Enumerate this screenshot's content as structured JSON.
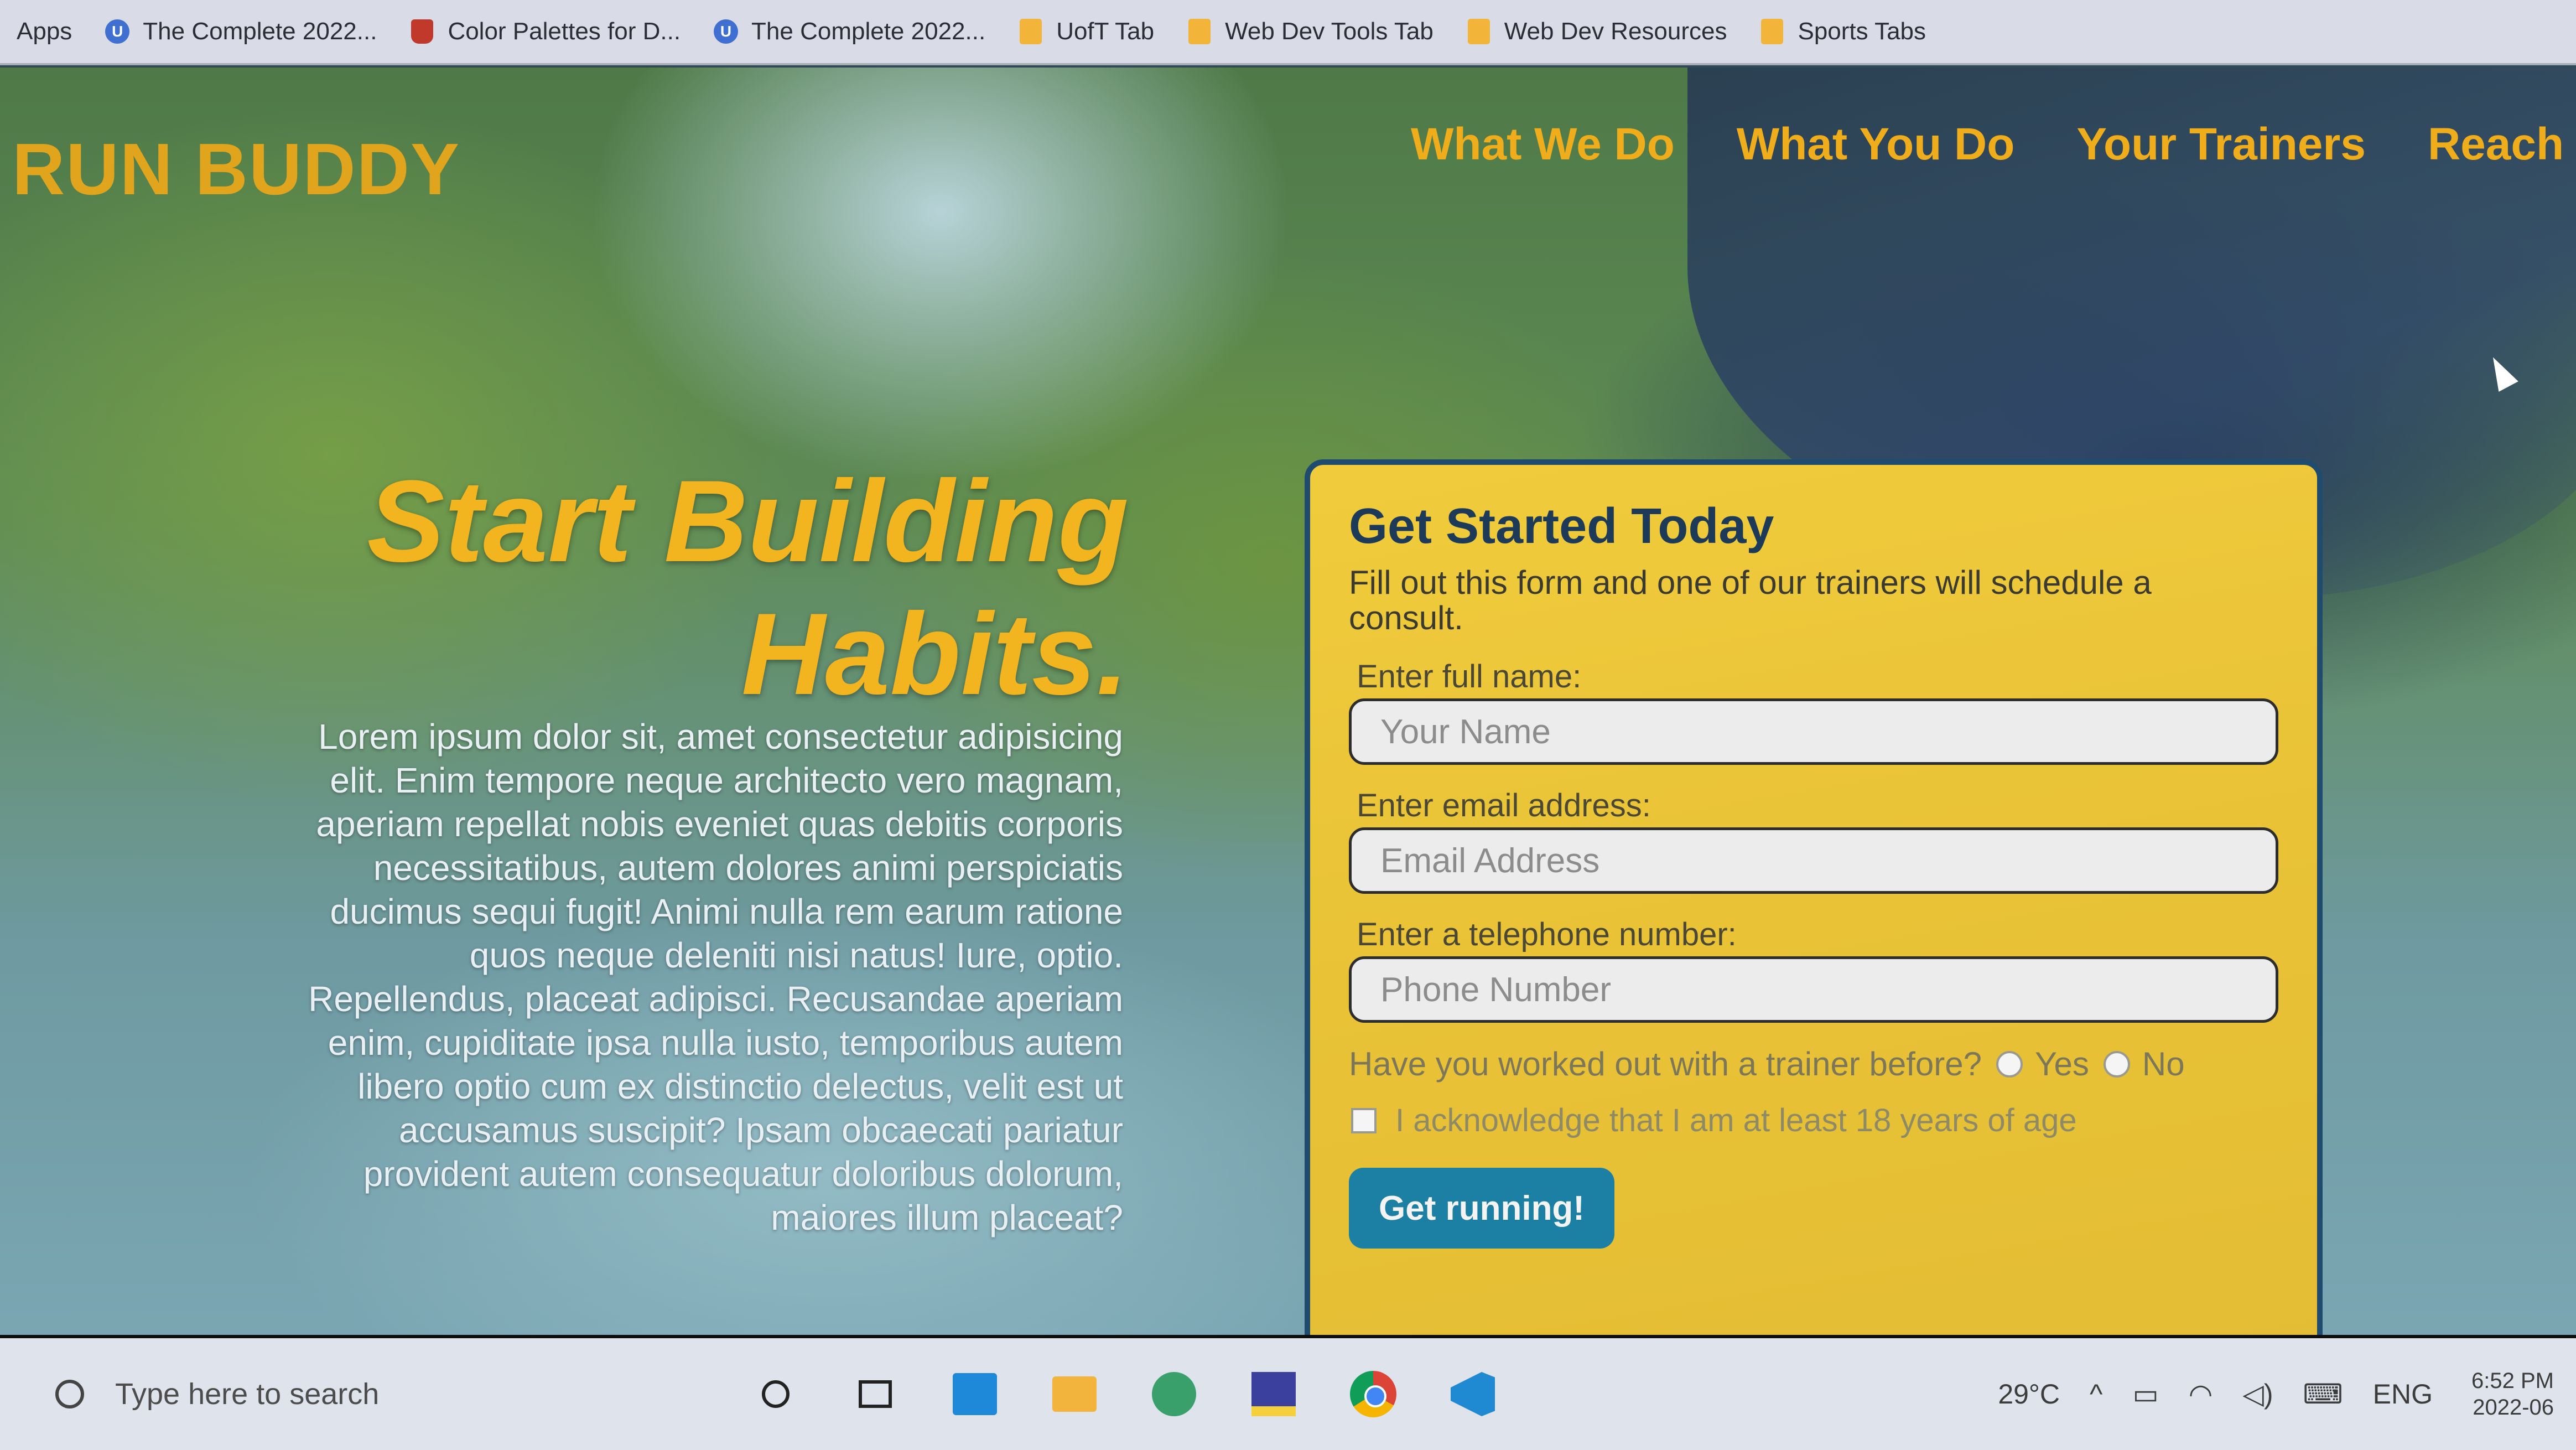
{
  "bookmarks": {
    "apps_label": "Apps",
    "items": [
      {
        "label": "The Complete 2022...",
        "icon": "site-icon"
      },
      {
        "label": "Color Palettes for D...",
        "icon": "site-icon"
      },
      {
        "label": "The Complete 2022...",
        "icon": "site-icon"
      },
      {
        "label": "UofT Tab",
        "icon": "folder-icon"
      },
      {
        "label": "Web Dev Tools Tab",
        "icon": "folder-icon"
      },
      {
        "label": "Web Dev Resources",
        "icon": "folder-icon"
      },
      {
        "label": "Sports Tabs",
        "icon": "folder-icon"
      }
    ]
  },
  "site": {
    "logo": "RUN BUDDY",
    "nav": [
      "What We Do",
      "What You Do",
      "Your Trainers",
      "Reach Ou"
    ]
  },
  "hero": {
    "headline_line1": "Start Building",
    "headline_line2": "Habits.",
    "body": "Lorem ipsum dolor sit, amet consectetur adipisicing elit. Enim tempore neque architecto vero magnam, aperiam repellat nobis eveniet quas debitis corporis necessitatibus, autem dolores animi perspiciatis ducimus sequi fugit! Animi nulla rem earum ratione quos neque deleniti nisi natus! Iure, optio. Repellendus, placeat adipisci. Recusandae aperiam enim, cupiditate ipsa nulla iusto, temporibus autem libero optio cum ex distinctio delectus, velit est ut accusamus suscipit? Ipsam obcaecati pariatur provident autem consequatur doloribus dolorum, maiores illum placeat?"
  },
  "form": {
    "title": "Get Started Today",
    "subtitle": "Fill out this form and one of our trainers will schedule a consult.",
    "name_label": "Enter full name:",
    "name_placeholder": "Your Name",
    "email_label": "Enter email address:",
    "email_placeholder": "Email Address",
    "phone_label": "Enter a telephone number:",
    "phone_placeholder": "Phone Number",
    "trainer_question": "Have you worked out with a trainer before?",
    "yes_label": "Yes",
    "no_label": "No",
    "age_ack": "I acknowledge that I am at least 18 years of age",
    "submit": "Get running!"
  },
  "taskbar": {
    "search_placeholder": "Type here to search",
    "temperature": "29°C",
    "language": "ENG",
    "time": "6:52 PM",
    "date": "2022-06"
  },
  "colors": {
    "accent": "#f0ad1b",
    "card": "#e9c236",
    "card_border": "#1f4c6e",
    "button": "#1c7fa4"
  }
}
